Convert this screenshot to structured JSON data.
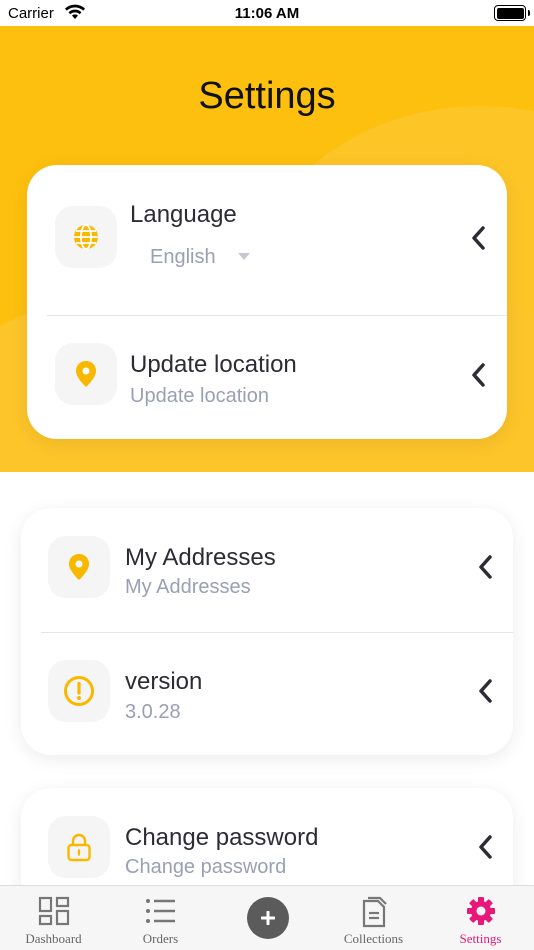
{
  "status_bar": {
    "carrier": "Carrier",
    "time": "11:06 AM"
  },
  "header": {
    "title": "Settings"
  },
  "card1": {
    "language": {
      "label": "Language",
      "value": "English"
    },
    "location": {
      "label": "Update location",
      "sub": "Update location"
    }
  },
  "card2": {
    "addresses": {
      "label": "My Addresses",
      "sub": "My Addresses"
    },
    "version": {
      "label": "version",
      "sub": "3.0.28"
    }
  },
  "card3": {
    "password": {
      "label": "Change password",
      "sub": "Change password"
    }
  },
  "tabbar": {
    "dashboard": "Dashboard",
    "orders": "Orders",
    "collections": "Collections",
    "settings": "Settings"
  },
  "colors": {
    "accent": "#fdc00f",
    "active_tab": "#e8177a",
    "icon_yellow": "#f9b800"
  },
  "icons": [
    "globe-icon",
    "location-pin-icon",
    "alert-circle-icon",
    "lock-icon",
    "chevron-left-icon",
    "grid-icon",
    "list-icon",
    "plus-icon",
    "document-icon",
    "gear-icon"
  ]
}
